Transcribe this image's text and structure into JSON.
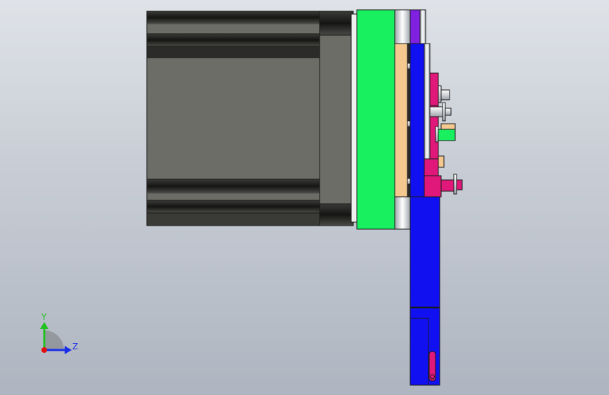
{
  "triad": {
    "y_label": "Y",
    "z_label": "Z",
    "y_color": "#22c022",
    "z_color": "#1a2ee8",
    "origin_color": "#e01010"
  },
  "colors": {
    "motor_body": "#6b6d66",
    "motor_dark": "#2e2f2b",
    "flange_green": "#18f060",
    "plate_blue": "#1010f0",
    "bracket_magenta": "#e0187a",
    "spacer_tan": "#f5c890",
    "purple_tab": "#8020e0",
    "steel_light": "#f2f2f2"
  }
}
